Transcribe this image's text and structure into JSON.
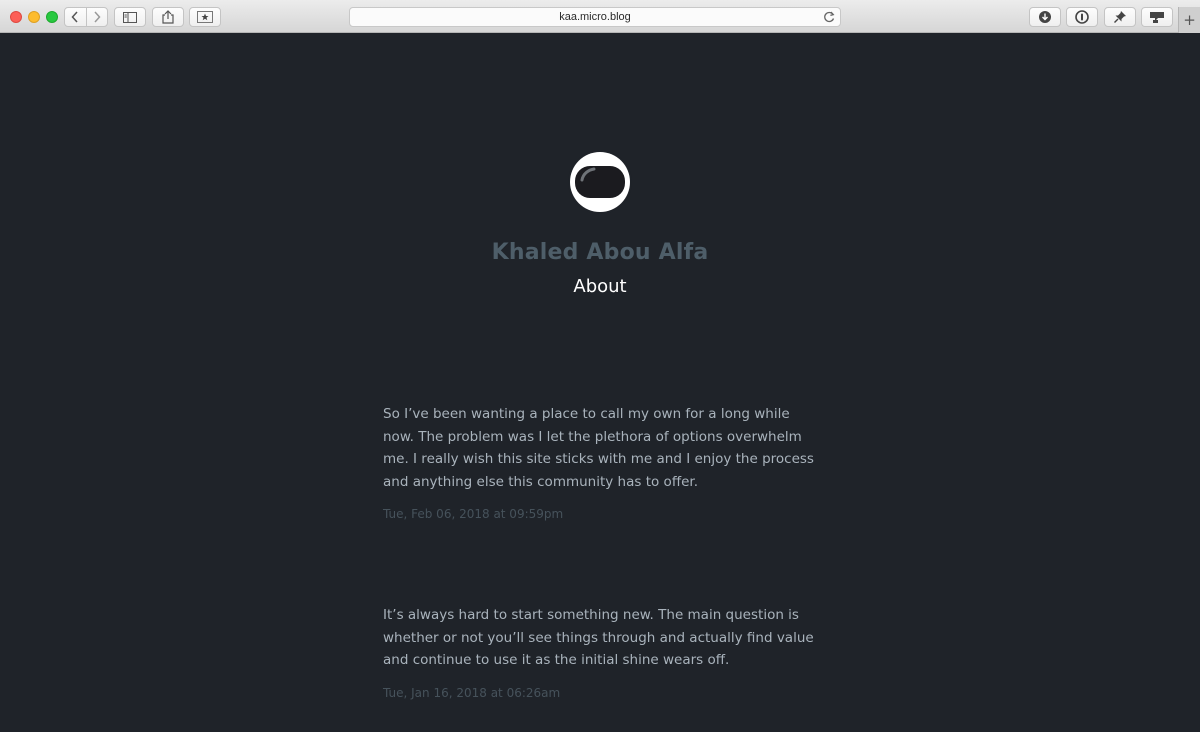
{
  "browser": {
    "url": "kaa.micro.blog",
    "new_tab_label": "+"
  },
  "site": {
    "title": "Khaled Abou Alfa",
    "nav_about": "About"
  },
  "posts": [
    {
      "body": "So I’ve been wanting a place to call my own for a long while now. The problem was I let the plethora of options overwhelm me. I really wish this site sticks with me and I enjoy the process and anything else this community has to offer.",
      "date": "Tue, Feb 06, 2018 at 09:59pm"
    },
    {
      "body": "It’s always hard to start something new. The main question is whether or not you’ll see things through and actually find value and continue to use it as the initial shine wears off.",
      "date": "Tue, Jan 16, 2018 at 06:26am"
    }
  ],
  "colors": {
    "background": "#1f2329",
    "title": "#4e5e69",
    "body_text": "#a9b3bc",
    "date_text": "#46525b"
  },
  "icons": [
    "close-window-icon",
    "minimize-window-icon",
    "zoom-window-icon",
    "back-icon",
    "forward-icon",
    "sidebar-icon",
    "share-icon",
    "bookmark-star-icon",
    "reload-icon",
    "download-icon",
    "password-icon",
    "pin-icon",
    "chat-icon"
  ]
}
